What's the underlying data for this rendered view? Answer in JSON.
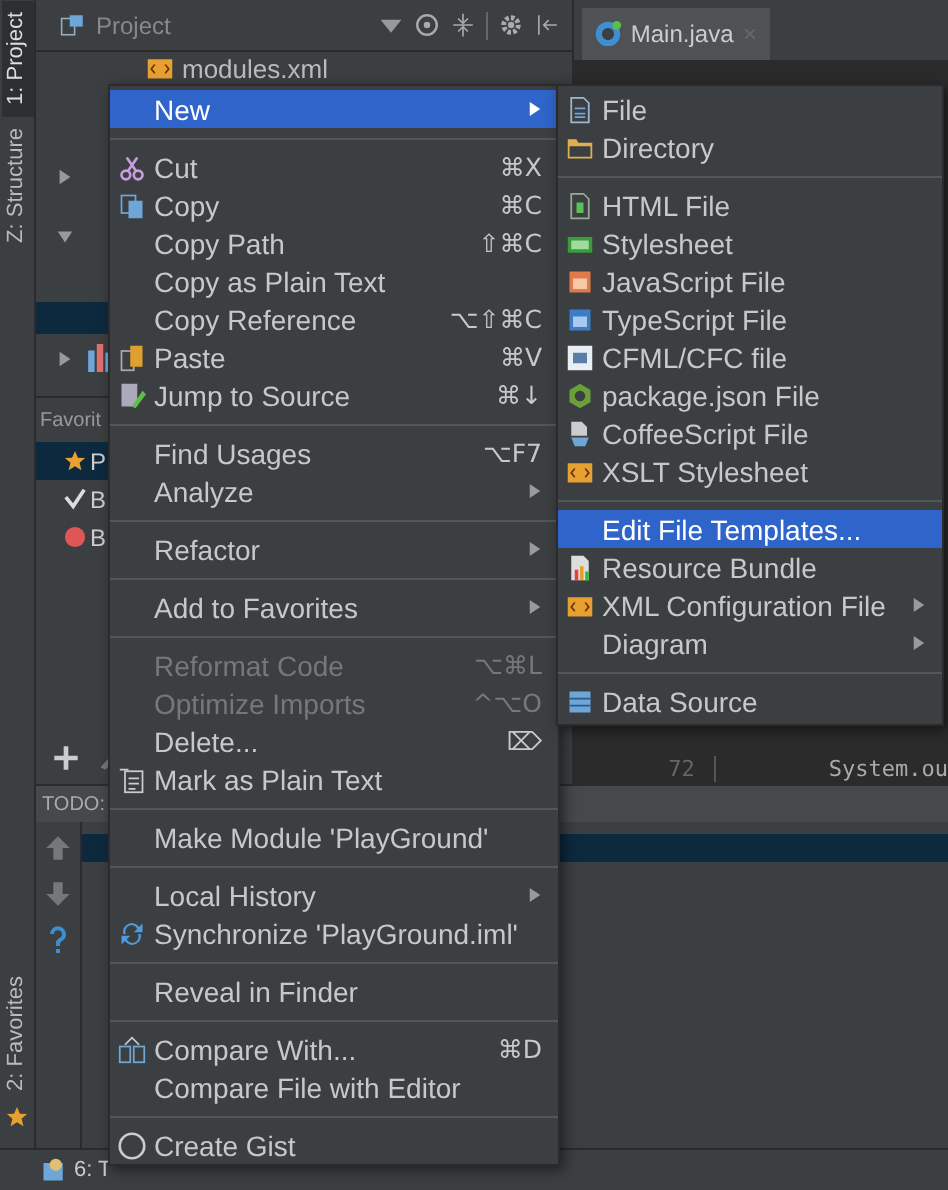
{
  "tool_strip": [
    {
      "label": "1: Project",
      "selected": true
    },
    {
      "label": "Z: Structure",
      "selected": false
    },
    {
      "label": "2: Favorites",
      "selected": false
    }
  ],
  "project_panel": {
    "title": "Project",
    "tree": [
      {
        "label": "modules.xml"
      }
    ],
    "favorites_title": "Favorit",
    "favorites": [
      {
        "label": "P",
        "selected": true
      },
      {
        "label": "B",
        "selected": false
      },
      {
        "label": "B",
        "selected": false
      }
    ]
  },
  "editor": {
    "tab": "Main.java",
    "line_number": "72",
    "code": "System.ou"
  },
  "todo_panel": {
    "title": "TODO:"
  },
  "bottom_bar": {
    "tab": "6: T"
  },
  "context_menu": {
    "groups": [
      {
        "items": [
          {
            "label": "New",
            "selected": true,
            "disabled": false,
            "has_submenu": true
          }
        ]
      },
      {
        "items": [
          {
            "label": "Cut",
            "shortcut": "⌘X",
            "selected": false,
            "disabled": false,
            "has_submenu": false
          },
          {
            "label": "Copy",
            "shortcut": "⌘C",
            "selected": false,
            "disabled": false,
            "has_submenu": false
          },
          {
            "label": "Copy Path",
            "shortcut": "⇧⌘C",
            "selected": false,
            "disabled": false,
            "has_submenu": false
          },
          {
            "label": "Copy as Plain Text",
            "selected": false,
            "disabled": false,
            "has_submenu": false
          },
          {
            "label": "Copy Reference",
            "shortcut": "⌥⇧⌘C",
            "selected": false,
            "disabled": false,
            "has_submenu": false
          },
          {
            "label": "Paste",
            "shortcut": "⌘V",
            "selected": false,
            "disabled": false,
            "has_submenu": false
          },
          {
            "label": "Jump to Source",
            "shortcut": "⌘↓",
            "selected": false,
            "disabled": false,
            "has_submenu": false
          }
        ]
      },
      {
        "items": [
          {
            "label": "Find Usages",
            "shortcut": "⌥F7",
            "selected": false,
            "disabled": false,
            "has_submenu": false
          },
          {
            "label": "Analyze",
            "selected": false,
            "disabled": false,
            "has_submenu": true
          }
        ]
      },
      {
        "items": [
          {
            "label": "Refactor",
            "selected": false,
            "disabled": false,
            "has_submenu": true
          }
        ]
      },
      {
        "items": [
          {
            "label": "Add to Favorites",
            "selected": false,
            "disabled": false,
            "has_submenu": true
          }
        ]
      },
      {
        "items": [
          {
            "label": "Reformat Code",
            "shortcut": "⌥⌘L",
            "selected": false,
            "disabled": true,
            "has_submenu": false
          },
          {
            "label": "Optimize Imports",
            "shortcut": "^⌥O",
            "selected": false,
            "disabled": true,
            "has_submenu": false
          },
          {
            "label": "Delete...",
            "shortcut": "⌦",
            "selected": false,
            "disabled": false,
            "has_submenu": false
          },
          {
            "label": "Mark as Plain Text",
            "selected": false,
            "disabled": false,
            "has_submenu": false
          }
        ]
      },
      {
        "items": [
          {
            "label": "Make Module 'PlayGround'",
            "selected": false,
            "disabled": false,
            "has_submenu": false
          }
        ]
      },
      {
        "items": [
          {
            "label": "Local History",
            "selected": false,
            "disabled": false,
            "has_submenu": true
          },
          {
            "label": "Synchronize 'PlayGround.iml'",
            "selected": false,
            "disabled": false,
            "has_submenu": false
          }
        ]
      },
      {
        "items": [
          {
            "label": "Reveal in Finder",
            "selected": false,
            "disabled": false,
            "has_submenu": false
          }
        ]
      },
      {
        "items": [
          {
            "label": "Compare With...",
            "shortcut": "⌘D",
            "selected": false,
            "disabled": false,
            "has_submenu": false
          },
          {
            "label": "Compare File with Editor",
            "selected": false,
            "disabled": false,
            "has_submenu": false
          }
        ]
      },
      {
        "items": [
          {
            "label": "Create Gist",
            "selected": false,
            "disabled": false,
            "has_submenu": false
          }
        ]
      }
    ]
  },
  "submenu": {
    "groups": [
      {
        "items": [
          {
            "label": "File",
            "selected": false,
            "has_submenu": false
          },
          {
            "label": "Directory",
            "selected": false,
            "has_submenu": false
          }
        ]
      },
      {
        "items": [
          {
            "label": "HTML File",
            "selected": false,
            "has_submenu": false
          },
          {
            "label": "Stylesheet",
            "selected": false,
            "has_submenu": false
          },
          {
            "label": "JavaScript File",
            "selected": false,
            "has_submenu": false
          },
          {
            "label": "TypeScript File",
            "selected": false,
            "has_submenu": false
          },
          {
            "label": "CFML/CFC file",
            "selected": false,
            "has_submenu": false
          },
          {
            "label": "package.json File",
            "selected": false,
            "has_submenu": false
          },
          {
            "label": "CoffeeScript File",
            "selected": false,
            "has_submenu": false
          },
          {
            "label": "XSLT Stylesheet",
            "selected": false,
            "has_submenu": false
          }
        ]
      },
      {
        "items": [
          {
            "label": "Edit File Templates...",
            "selected": true,
            "has_submenu": false
          },
          {
            "label": "Resource Bundle",
            "selected": false,
            "has_submenu": false
          },
          {
            "label": "XML Configuration File",
            "selected": false,
            "has_submenu": true
          },
          {
            "label": "Diagram",
            "selected": false,
            "has_submenu": true
          }
        ]
      },
      {
        "items": [
          {
            "label": "Data Source",
            "selected": false,
            "has_submenu": false
          }
        ]
      }
    ]
  }
}
